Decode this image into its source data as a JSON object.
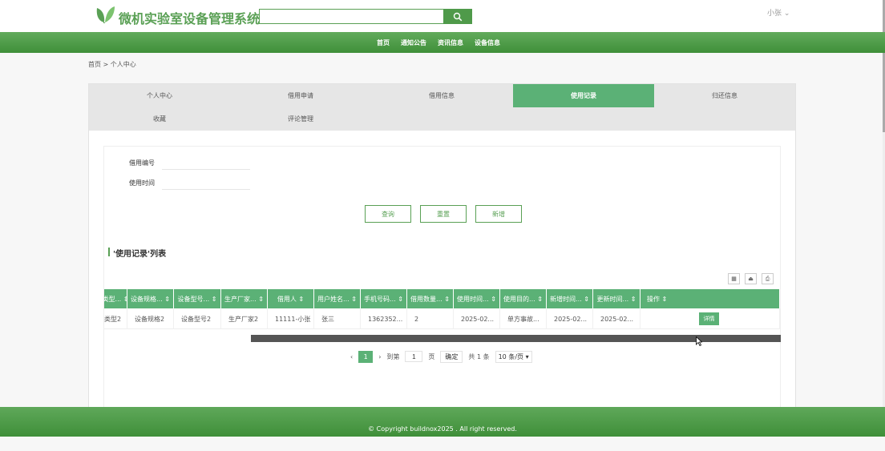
{
  "header": {
    "site_title": "微机实验室设备管理系统",
    "search_placeholder": "",
    "search_icon": "search-icon",
    "user_name": "小张",
    "brand_color": "#5aa055"
  },
  "nav": {
    "items": [
      "首页",
      "通知公告",
      "资讯信息",
      "设备信息"
    ]
  },
  "breadcrumb": "首页 > 个人中心",
  "tabs": [
    {
      "label": "个人中心",
      "active": false
    },
    {
      "label": "借用申请",
      "active": false
    },
    {
      "label": "借用信息",
      "active": false
    },
    {
      "label": "使用记录",
      "active": true
    },
    {
      "label": "归还信息",
      "active": false
    },
    {
      "label": "收藏",
      "active": false
    },
    {
      "label": "评论管理",
      "active": false
    }
  ],
  "filters": {
    "borrow_no_label": "借用编号",
    "use_time_label": "使用时间"
  },
  "buttons": {
    "query": "查询",
    "reset": "重置",
    "add": "新增"
  },
  "list_title": "'使用记录'列表",
  "toolbar_icons": [
    "columns-icon",
    "export-icon",
    "print-icon"
  ],
  "table": {
    "columns": [
      "类型...",
      "设备规格...",
      "设备型号...",
      "生产厂家...",
      "借用人",
      "用户姓名...",
      "手机号码...",
      "借用数量...",
      "使用时间...",
      "使用目的...",
      "新增时间...",
      "更新时间...",
      "操作"
    ],
    "rows": [
      [
        "类型2",
        "设备规格2",
        "设备型号2",
        "生产厂家2",
        "11111-小张",
        "张三",
        "1362352...",
        "2",
        "2025-02...",
        "单方事故...",
        "2025-02...",
        "2025-02..."
      ]
    ],
    "detail_label": "详情",
    "accent": "#5bb176"
  },
  "pagination": {
    "current_page": "1",
    "goto_label": "到第",
    "goto_value": "1",
    "page_label": "页",
    "confirm": "确定",
    "total": "共 1 条",
    "page_size": "10 条/页"
  },
  "footer": {
    "copyright": "© Copyright buildnox2025 . All right reserved."
  }
}
